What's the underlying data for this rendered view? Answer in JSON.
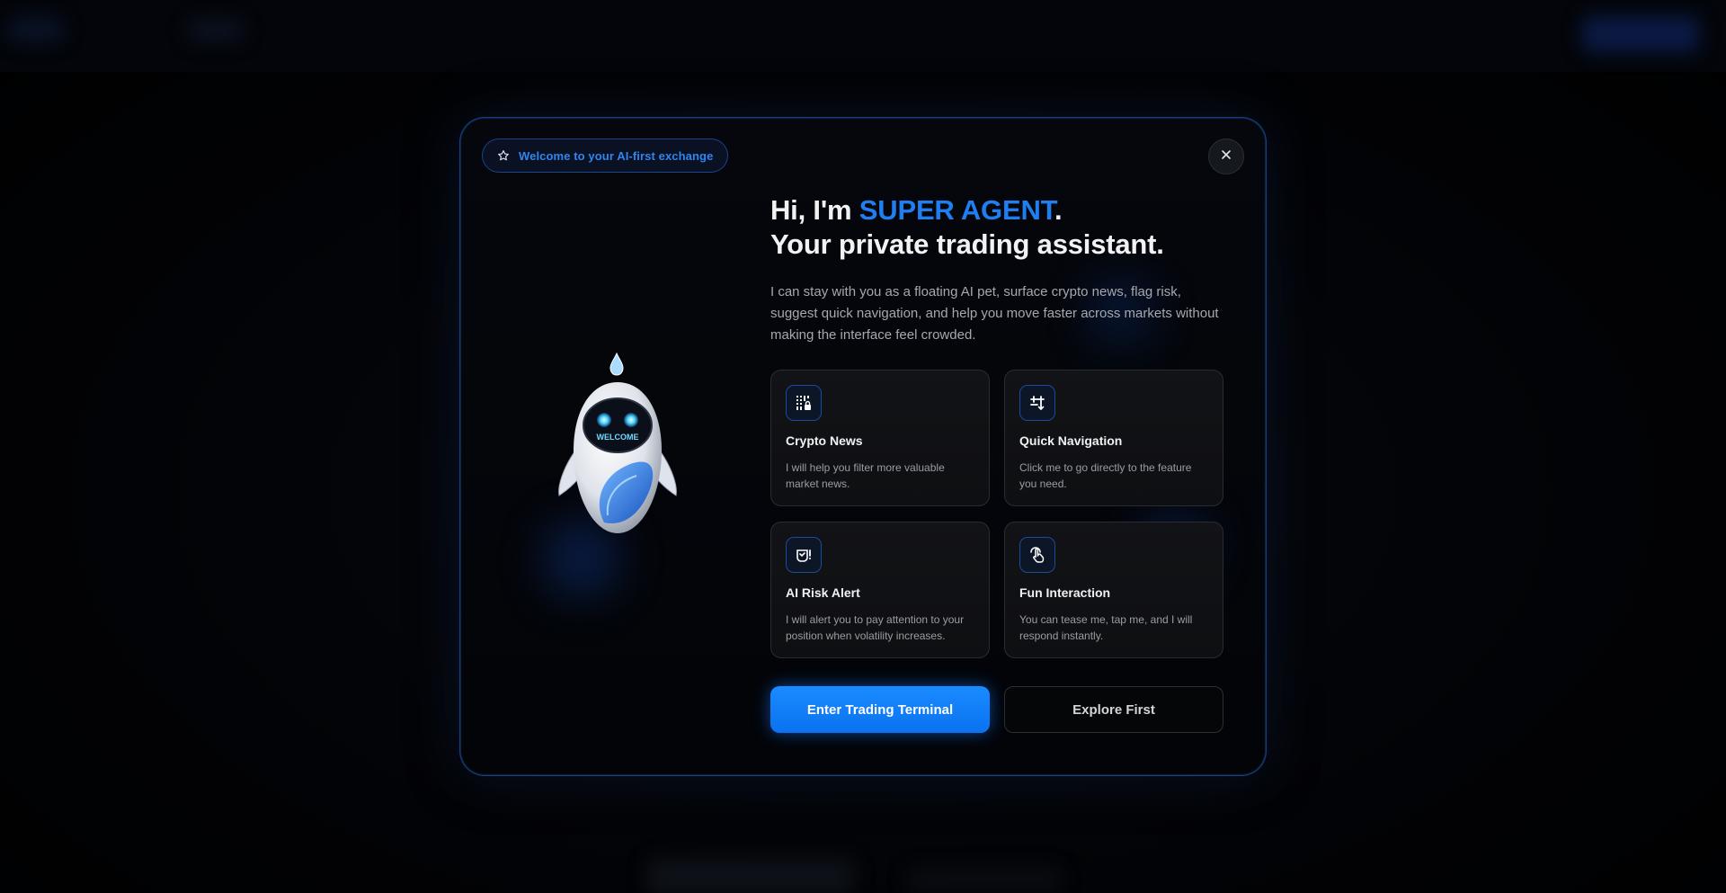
{
  "badge": {
    "icon": "star-icon",
    "label": "Welcome to your AI-first exchange"
  },
  "close": {
    "icon": "close-icon",
    "glyph": "×"
  },
  "robot": {
    "icon": "robot-mascot-icon",
    "screen_text": "WELCOME"
  },
  "headline": {
    "prefix": "Hi, I'm ",
    "accent": "SUPER AGENT",
    "suffix": ".",
    "line2": "Your private trading assistant."
  },
  "description": "I can stay with you as a floating AI pet, surface crypto news, flag risk, suggest quick navigation, and help you move faster across markets without making the interface feel crowded.",
  "features": [
    {
      "icon": "news-icon",
      "title": "Crypto News",
      "text": "I will help you filter more valuable market news."
    },
    {
      "icon": "navigation-icon",
      "title": "Quick Navigation",
      "text": "Click me to go directly to the feature you need."
    },
    {
      "icon": "risk-alert-icon",
      "title": "AI Risk Alert",
      "text": "I will alert you to pay attention to your position when volatility increases."
    },
    {
      "icon": "tap-icon",
      "title": "Fun Interaction",
      "text": "You can tease me, tap me, and I will respond instantly."
    }
  ],
  "actions": {
    "primary": "Enter Trading Terminal",
    "secondary": "Explore First"
  },
  "colors": {
    "accent": "#1f7ef0",
    "primary_button": "#0a7cff",
    "border_glow": "#286ee6",
    "background": "#000000"
  }
}
